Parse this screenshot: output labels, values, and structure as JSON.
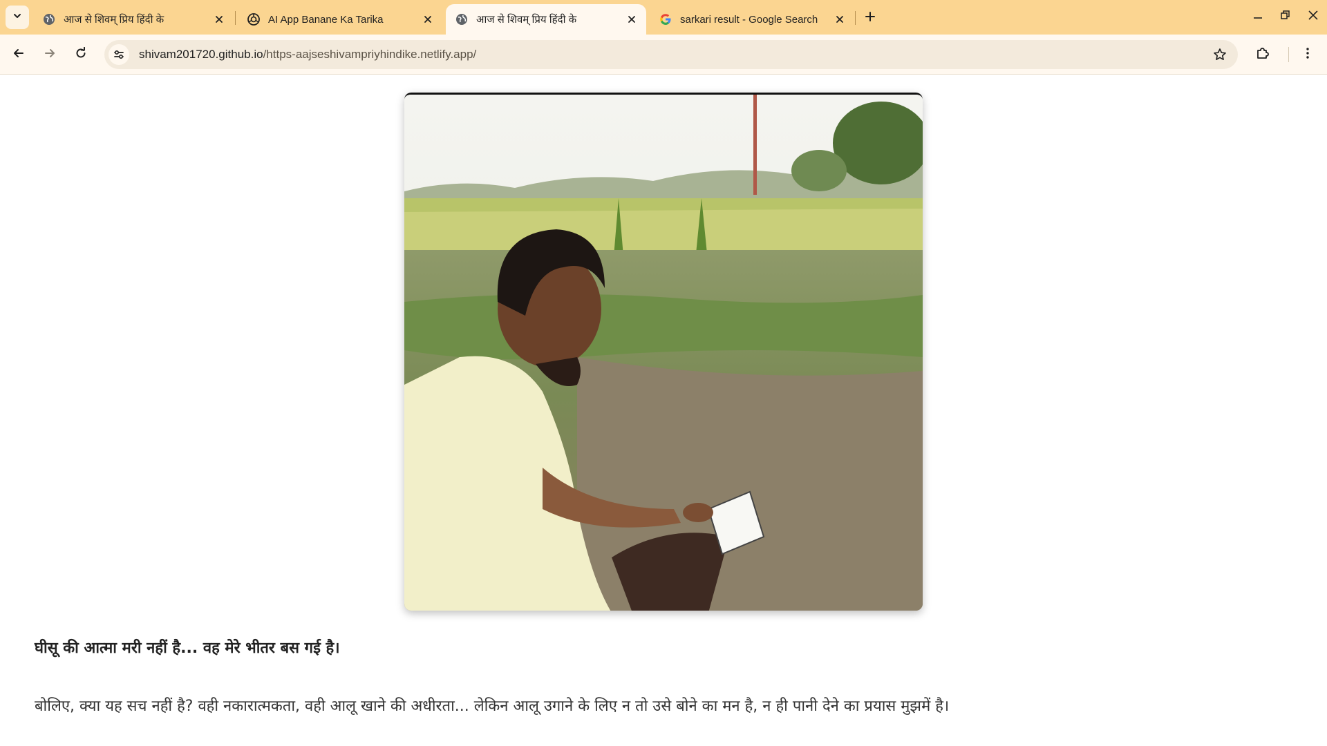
{
  "tabs": [
    {
      "title": "आज से शिवम् प्रिय हिंदी के",
      "favicon": "globe-icon",
      "active": false
    },
    {
      "title": "AI App Banane Ka Tarika",
      "favicon": "openai-icon",
      "active": false
    },
    {
      "title": "आज से शिवम् प्रिय हिंदी के",
      "favicon": "globe-icon",
      "active": true
    },
    {
      "title": "sarkari result - Google Search",
      "favicon": "google-icon",
      "active": false
    }
  ],
  "address_bar": {
    "host": "shivam201720.github.io",
    "path": "/https-aajseshivampriyhindike.netlify.app/"
  },
  "article": {
    "headline": "घीसू की आत्मा मरी नहीं है... वह मेरे भीतर बस गई है।",
    "paragraph": "बोलिए, क्या यह सच नहीं है? वही नकारात्मकता, वही आलू खाने की अधीरता... लेकिन आलू उगाने के लिए न तो उसे बोने का मन है, न ही पानी देने का प्रयास मुझमें है।"
  },
  "colors": {
    "tabstrip": "#fbd591",
    "toolbar": "#fff8ef",
    "omnibox": "#f3eadc"
  }
}
